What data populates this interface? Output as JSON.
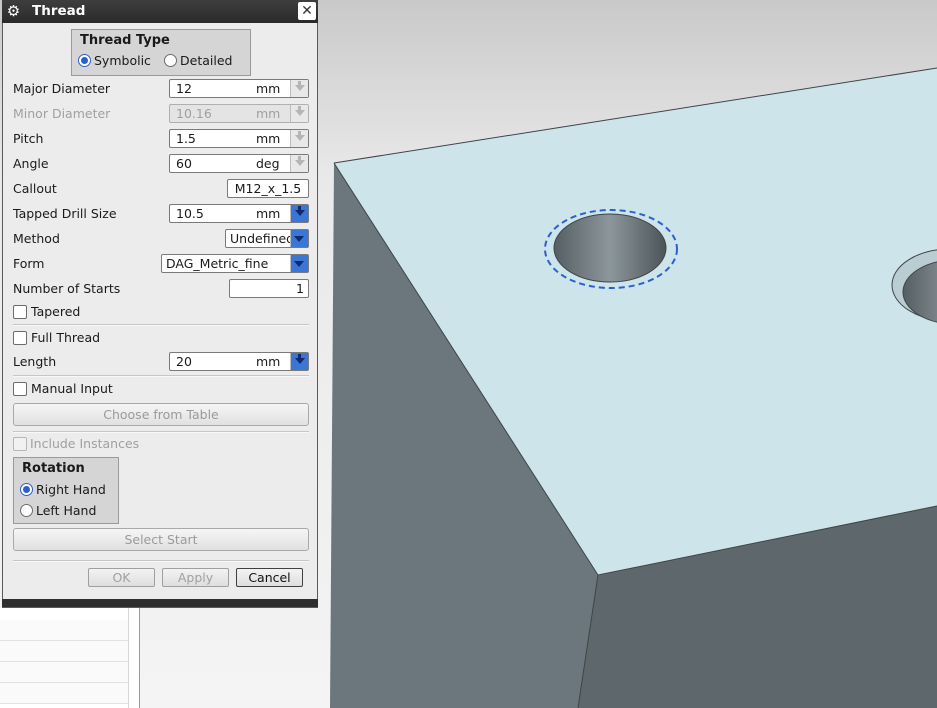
{
  "dialog": {
    "title": "Thread",
    "close_label": "✕",
    "thread_type": {
      "title": "Thread Type",
      "options": [
        "Symbolic",
        "Detailed"
      ],
      "selected": "Symbolic"
    },
    "fields": {
      "major_diameter": {
        "label": "Major Diameter",
        "value": "12",
        "unit": "mm"
      },
      "minor_diameter": {
        "label": "Minor Diameter",
        "value": "10.16",
        "unit": "mm"
      },
      "pitch": {
        "label": "Pitch",
        "value": "1.5",
        "unit": "mm"
      },
      "angle": {
        "label": "Angle",
        "value": "60",
        "unit": "deg"
      },
      "callout": {
        "label": "Callout",
        "value": "M12_x_1.5"
      },
      "tapped_drill_size": {
        "label": "Tapped Drill Size",
        "value": "10.5",
        "unit": "mm"
      },
      "method": {
        "label": "Method",
        "value": "Undefined"
      },
      "form": {
        "label": "Form",
        "value": "DAG_Metric_fine"
      },
      "number_of_starts": {
        "label": "Number of Starts",
        "value": "1"
      },
      "length": {
        "label": "Length",
        "value": "20",
        "unit": "mm"
      }
    },
    "checkboxes": {
      "tapered": "Tapered",
      "full_thread": "Full Thread",
      "manual_input": "Manual Input",
      "include_instances": "Include Instances"
    },
    "choose_from_table_label": "Choose from Table",
    "rotation": {
      "title": "Rotation",
      "options": [
        "Right Hand",
        "Left Hand"
      ],
      "selected": "Right Hand"
    },
    "select_start_label": "Select Start",
    "buttons": {
      "ok": "OK",
      "apply": "Apply",
      "cancel": "Cancel"
    }
  },
  "colors": {
    "viewport_background": "#d9d9d9",
    "block_top_face": "#cde4ea",
    "block_side_face": "#6e7a80",
    "selection_highlight": "#2a5fd0"
  }
}
